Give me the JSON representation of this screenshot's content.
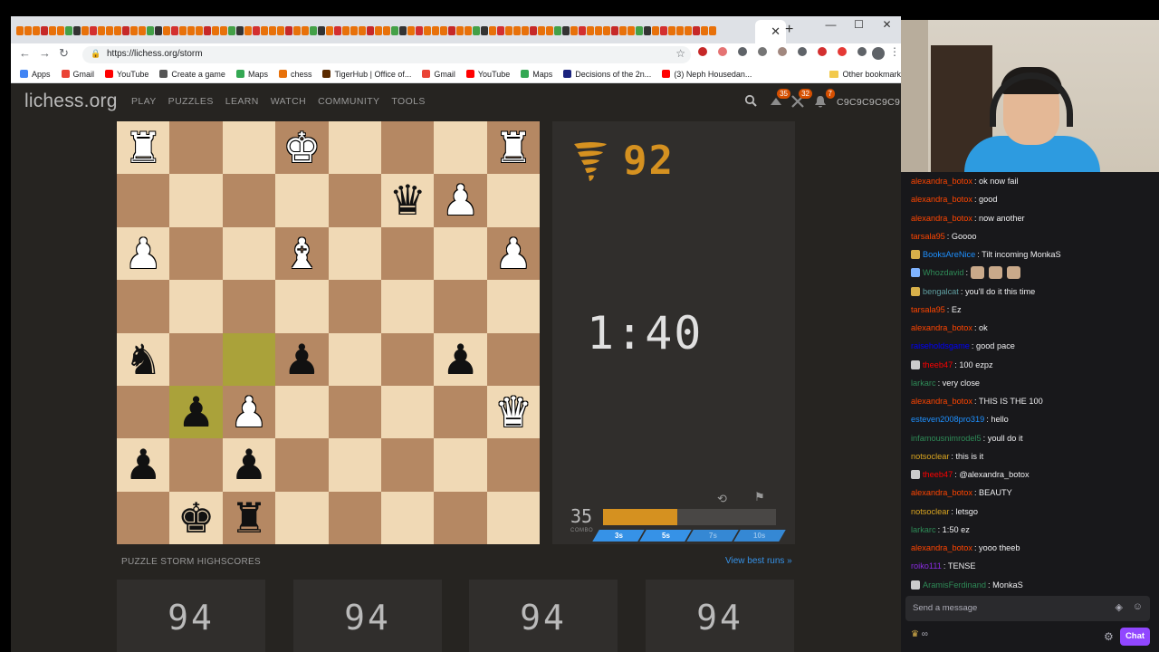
{
  "browser": {
    "url": "https://lichess.org/storm",
    "window_controls": [
      "—",
      "☐",
      "✕"
    ],
    "new_tab": "+",
    "bookmarks": [
      {
        "label": "Apps",
        "color": "#4285f4"
      },
      {
        "label": "Gmail",
        "color": "#ea4335"
      },
      {
        "label": "YouTube",
        "color": "#ff0000"
      },
      {
        "label": "Create a game",
        "color": "#555555"
      },
      {
        "label": "Maps",
        "color": "#34a853"
      },
      {
        "label": "chess",
        "color": "#e8710a"
      },
      {
        "label": "TigerHub | Office of...",
        "color": "#5b2b00"
      },
      {
        "label": "Gmail",
        "color": "#ea4335"
      },
      {
        "label": "YouTube",
        "color": "#ff0000"
      },
      {
        "label": "Maps",
        "color": "#34a853"
      },
      {
        "label": "Decisions of the 2n...",
        "color": "#1a237e"
      },
      {
        "label": "(3) Neph Housedan...",
        "color": "#ff0000"
      }
    ],
    "other_bookmarks": "Other bookmark"
  },
  "lichess": {
    "logo": "lichess.org",
    "nav": [
      "PLAY",
      "PUZZLES",
      "LEARN",
      "WATCH",
      "COMMUNITY",
      "TOOLS"
    ],
    "notif_counts": [
      "35",
      "32",
      "7"
    ],
    "username": "C9C9C9C9C9"
  },
  "board": {
    "highlights": [
      [
        5,
        1
      ],
      [
        4,
        2
      ]
    ],
    "pieces": [
      {
        "row": 0,
        "col": 0,
        "glyph": "♜",
        "color": "w"
      },
      {
        "row": 0,
        "col": 3,
        "glyph": "♚",
        "color": "w"
      },
      {
        "row": 0,
        "col": 7,
        "glyph": "♜",
        "color": "w"
      },
      {
        "row": 1,
        "col": 5,
        "glyph": "♛",
        "color": "b"
      },
      {
        "row": 1,
        "col": 6,
        "glyph": "♟",
        "color": "w"
      },
      {
        "row": 2,
        "col": 0,
        "glyph": "♟",
        "color": "w"
      },
      {
        "row": 2,
        "col": 3,
        "glyph": "♝",
        "color": "w"
      },
      {
        "row": 2,
        "col": 7,
        "glyph": "♟",
        "color": "w"
      },
      {
        "row": 4,
        "col": 0,
        "glyph": "♞",
        "color": "b"
      },
      {
        "row": 4,
        "col": 3,
        "glyph": "♟",
        "color": "b"
      },
      {
        "row": 4,
        "col": 6,
        "glyph": "♟",
        "color": "b"
      },
      {
        "row": 5,
        "col": 1,
        "glyph": "♟",
        "color": "b"
      },
      {
        "row": 5,
        "col": 2,
        "glyph": "♟",
        "color": "w"
      },
      {
        "row": 5,
        "col": 7,
        "glyph": "♛",
        "color": "w"
      },
      {
        "row": 6,
        "col": 0,
        "glyph": "♟",
        "color": "b"
      },
      {
        "row": 6,
        "col": 2,
        "glyph": "♟",
        "color": "b"
      },
      {
        "row": 7,
        "col": 1,
        "glyph": "♚",
        "color": "b"
      },
      {
        "row": 7,
        "col": 2,
        "glyph": "♜",
        "color": "b"
      }
    ]
  },
  "storm": {
    "score": "92",
    "clock": "1:40",
    "combo": "35",
    "combo_label": "COMBO",
    "combo_progress": 0.43,
    "levels": [
      {
        "label": "3s",
        "active": true
      },
      {
        "label": "5s",
        "active": true
      },
      {
        "label": "7s",
        "active": false
      },
      {
        "label": "10s",
        "active": false
      }
    ]
  },
  "highscores": {
    "title": "PUZZLE STORM HIGHSCORES",
    "link": "View best runs »",
    "cards": [
      "94",
      "94",
      "94",
      "94"
    ]
  },
  "chat": {
    "messages": [
      {
        "user": "alexandra_botox",
        "color": "#ff4500",
        "text": ": ok now fail"
      },
      {
        "user": "alexandra_botox",
        "color": "#ff4500",
        "text": ": good"
      },
      {
        "user": "alexandra_botox",
        "color": "#ff4500",
        "text": ": now another"
      },
      {
        "user": "tarsala95",
        "color": "#ff4500",
        "text": ": Goooo"
      },
      {
        "user": "BooksAreNice",
        "color": "#1e90ff",
        "text": ": Tilt incoming MonkaS",
        "badge": "#d8b04a"
      },
      {
        "user": "Whozdavid",
        "color": "#2e8b57",
        "text": ":",
        "badge": "#7fb3ff",
        "emotes": 3
      },
      {
        "user": "bengalcat",
        "color": "#5f9ea0",
        "text": ": you'll do it this time",
        "badge": "#d8b04a"
      },
      {
        "user": "tarsala95",
        "color": "#ff4500",
        "text": ": Ez"
      },
      {
        "user": "alexandra_botox",
        "color": "#ff4500",
        "text": ": ok"
      },
      {
        "user": "raiseholdsgame",
        "color": "#0000ff",
        "text": ": good pace"
      },
      {
        "user": "theeb47",
        "color": "#ff0000",
        "text": ": 100 ezpz",
        "badge": "#cccccc"
      },
      {
        "user": "larkarc",
        "color": "#2e8b57",
        "text": ": very close"
      },
      {
        "user": "alexandra_botox",
        "color": "#ff4500",
        "text": ": THIS IS THE 100"
      },
      {
        "user": "esteven2008pro319",
        "color": "#1e90ff",
        "text": ": hello"
      },
      {
        "user": "infamousnimrodel5",
        "color": "#2e8b57",
        "text": ": youll do it"
      },
      {
        "user": "notsoclear",
        "color": "#daa520",
        "text": ": this is it"
      },
      {
        "user": "theeb47",
        "color": "#ff0000",
        "text": ": @alexandra_botox",
        "badge": "#cccccc"
      },
      {
        "user": "alexandra_botox",
        "color": "#ff4500",
        "text": ": BEAUTY"
      },
      {
        "user": "notsoclear",
        "color": "#daa520",
        "text": ": letsgo"
      },
      {
        "user": "larkarc",
        "color": "#2e8b57",
        "text": ": 1:50 ez"
      },
      {
        "user": "alexandra_botox",
        "color": "#ff4500",
        "text": ": yooo theeb"
      },
      {
        "user": "roiko111",
        "color": "#8a2be2",
        "text": ": TENSE"
      },
      {
        "user": "AramisFerdinand",
        "color": "#2e8b57",
        "text": ": MonkaS",
        "badge": "#cccccc"
      }
    ],
    "input_placeholder": "Send a message",
    "bottom_text": "∞",
    "chat_button": "Chat"
  },
  "colors": {
    "accent_orange": "#d59120",
    "accent_blue": "#3692e7",
    "twitch_purple": "#9147ff"
  }
}
